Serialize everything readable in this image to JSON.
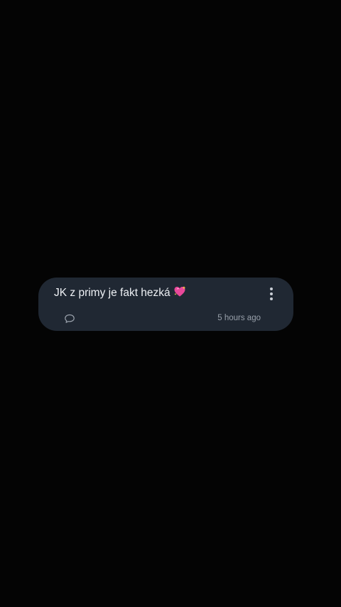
{
  "post": {
    "text": "JK z primy je fakt hezká",
    "emoji": "sparkling-heart-icon",
    "timestamp": "5 hours ago"
  },
  "icons": {
    "comment": "comment-icon",
    "more": "more-options-icon"
  },
  "colors": {
    "background": "#040404",
    "card": "#202833",
    "text": "#eef1f5",
    "muted": "#98a0aa",
    "emoji_pink": "#e8489a"
  }
}
